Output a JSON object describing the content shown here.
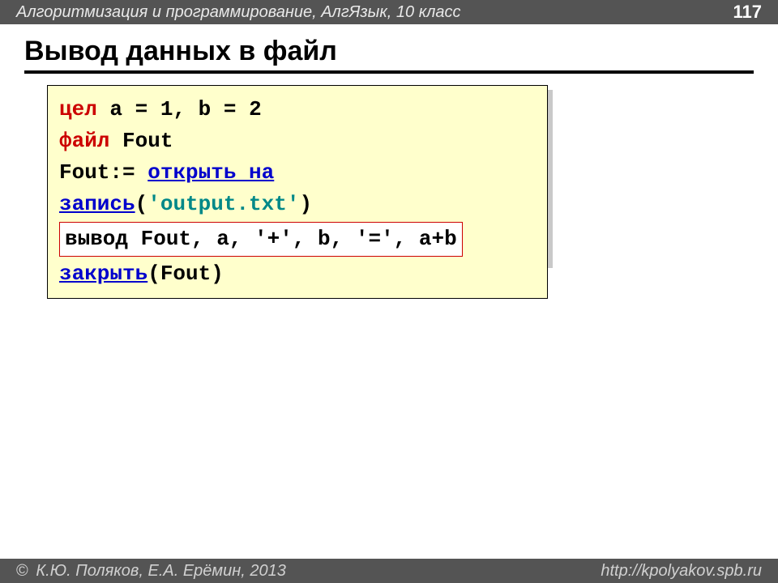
{
  "header": {
    "breadcrumb": "Алгоритмизация и программирование, АлгЯзык, 10 класс",
    "page_number": "117"
  },
  "title": "Вывод данных в файл",
  "code": {
    "line1": {
      "kw": "цел",
      "rest_a": " a",
      "eq1": "=",
      "one": "1",
      "comma_b": ", b",
      "eq2": "=",
      "two": "2"
    },
    "line2": {
      "kw": "файл",
      "rest": " Fout"
    },
    "line3": {
      "assign": "Fout:=",
      "func": "открыть на запись",
      "paren_open": "(",
      "str": "'output.txt'",
      "paren_close": ")"
    },
    "line4": {
      "content": "вывод Fout, a, '+', b, '=', a+b"
    },
    "line5": {
      "func": "закрыть",
      "args": "(Fout)"
    }
  },
  "footer": {
    "copyright_symbol": "©",
    "copyright": "К.Ю. Поляков, Е.А. Ерёмин, 2013",
    "url": "http://kpolyakov.spb.ru"
  }
}
